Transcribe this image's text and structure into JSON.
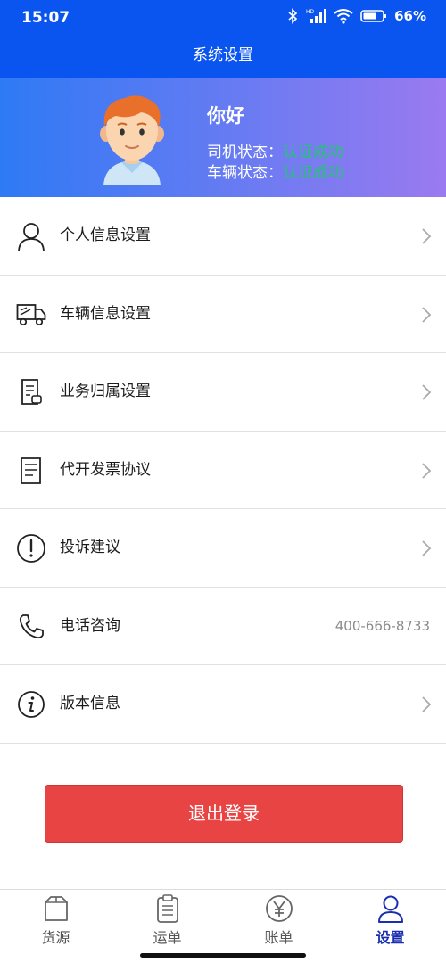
{
  "status_bar": {
    "time": "15:07",
    "battery_text": "66%",
    "icons": [
      "bluetooth-icon",
      "signal-icon",
      "wifi-icon",
      "battery-icon"
    ]
  },
  "header": {
    "title": "系统设置"
  },
  "profile": {
    "greeting": "你好",
    "driver_status_label": "司机状态：",
    "driver_status_value": "认证成功",
    "vehicle_status_label": "车辆状态：",
    "vehicle_status_value": "认证成功",
    "status_color": "#27c27a"
  },
  "menu": [
    {
      "label": "个人信息设置",
      "icon": "person-icon"
    },
    {
      "label": "车辆信息设置",
      "icon": "truck-icon"
    },
    {
      "label": "业务归属设置",
      "icon": "document-icon"
    },
    {
      "label": "代开发票协议",
      "icon": "invoice-icon"
    },
    {
      "label": "投诉建议",
      "icon": "exclamation-icon"
    },
    {
      "label": "电话咨询",
      "icon": "phone-icon",
      "value": "400-666-8733"
    },
    {
      "label": "版本信息",
      "icon": "info-icon"
    }
  ],
  "logout": {
    "label": "退出登录",
    "color": "#e84444"
  },
  "tabs": [
    {
      "label": "货源",
      "icon": "box-icon",
      "active": false
    },
    {
      "label": "运单",
      "icon": "clipboard-icon",
      "active": false
    },
    {
      "label": "账单",
      "icon": "yen-icon",
      "active": false
    },
    {
      "label": "设置",
      "icon": "user-icon",
      "active": true
    }
  ],
  "colors": {
    "primary": "#0a55f0",
    "active_tab": "#1a2fb0"
  }
}
